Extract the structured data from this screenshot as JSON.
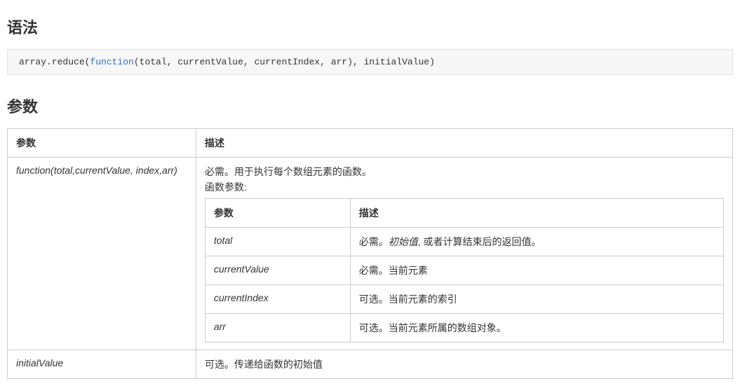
{
  "syntax": {
    "heading": "语法",
    "code_prefix": "array.reduce(",
    "code_keyword": "function",
    "code_suffix": "(total, currentValue, currentIndex, arr), initialValue)"
  },
  "params": {
    "heading": "参数",
    "header_param": "参数",
    "header_desc": "描述",
    "rows": [
      {
        "name": "function(total,currentValue, index,arr)",
        "desc_intro": "必需。用于执行每个数组元素的函数。",
        "desc_sublabel": "函数参数:",
        "inner_header_param": "参数",
        "inner_header_desc": "描述",
        "inner_rows": [
          {
            "name": "total",
            "desc_prefix": "必需。",
            "desc_italic": "初始值",
            "desc_suffix": ", 或者计算结束后的返回值。"
          },
          {
            "name": "currentValue",
            "desc": "必需。当前元素"
          },
          {
            "name": "currentIndex",
            "desc": "可选。当前元素的索引"
          },
          {
            "name": "arr",
            "desc": "可选。当前元素所属的数组对象。"
          }
        ]
      },
      {
        "name": "initialValue",
        "desc": "可选。传递给函数的初始值"
      }
    ]
  }
}
